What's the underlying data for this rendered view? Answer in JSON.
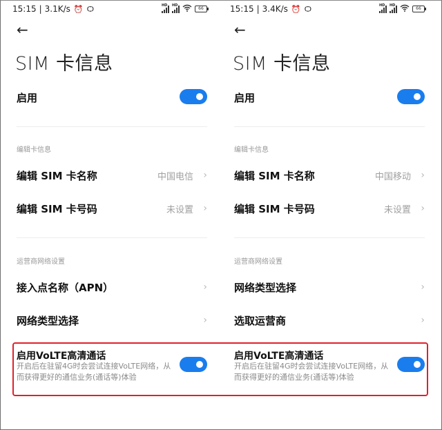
{
  "panels": [
    {
      "status": {
        "time": "15:15",
        "separator": "|",
        "speed": "3.1K/s",
        "alarm_icon": "⏰",
        "app_icon": "Ѻ",
        "battery": "66"
      },
      "title": "SIM 卡信息",
      "enable": {
        "label": "启用",
        "on": true
      },
      "section1": {
        "header": "编辑卡信息",
        "items": [
          {
            "label": "编辑 SIM 卡名称",
            "value": "中国电信"
          },
          {
            "label": "编辑 SIM 卡号码",
            "value": "未设置"
          }
        ]
      },
      "section2": {
        "header": "运营商网络设置",
        "items": [
          {
            "label": "接入点名称（APN）",
            "value": ""
          },
          {
            "label": "网络类型选择",
            "value": ""
          }
        ]
      },
      "volte": {
        "title": "启用VoLTE高清通话",
        "description": "开启后在驻留4G时会尝试连接VoLTE网络，从而获得更好的通信业务(通话等)体验",
        "on": true
      }
    },
    {
      "status": {
        "time": "15:15",
        "separator": "|",
        "speed": "3.4K/s",
        "alarm_icon": "⏰",
        "app_icon": "Ѻ",
        "battery": "66"
      },
      "title": "SIM 卡信息",
      "enable": {
        "label": "启用",
        "on": true
      },
      "section1": {
        "header": "编辑卡信息",
        "items": [
          {
            "label": "编辑 SIM 卡名称",
            "value": "中国移动"
          },
          {
            "label": "编辑 SIM 卡号码",
            "value": "未设置"
          }
        ]
      },
      "section2": {
        "header": "运营商网络设置",
        "items": [
          {
            "label": "网络类型选择",
            "value": ""
          },
          {
            "label": "选取运营商",
            "value": ""
          }
        ]
      },
      "volte": {
        "title": "启用VoLTE高清通话",
        "description": "开启后在驻留4G时会尝试连接VoLTE网络，从而获得更好的通信业务(通话等)体验",
        "on": true
      }
    }
  ],
  "icons": {
    "back": "←",
    "chevron": "›",
    "wifi": "◠"
  },
  "colors": {
    "accent": "#1a7dee",
    "highlight": "#e0202a"
  }
}
